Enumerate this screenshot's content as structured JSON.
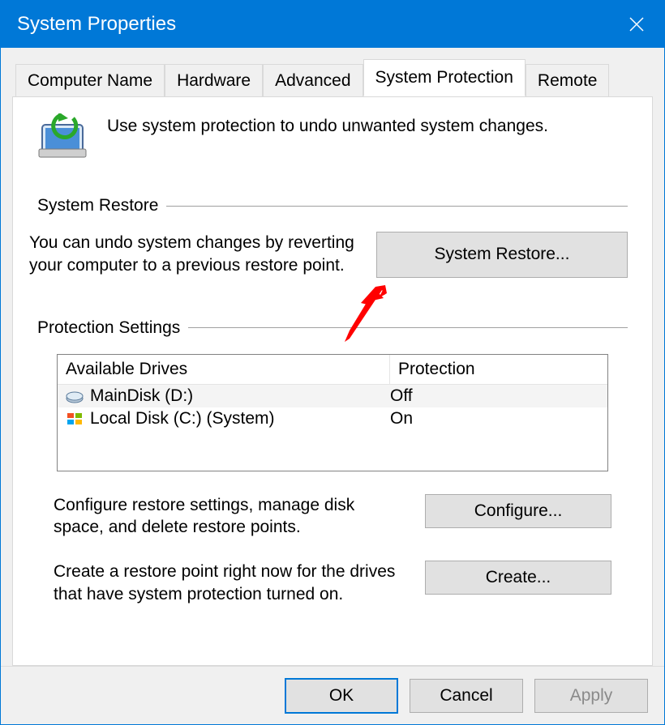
{
  "window": {
    "title": "System Properties"
  },
  "tabs": {
    "computer_name": "Computer Name",
    "hardware": "Hardware",
    "advanced": "Advanced",
    "system_protection": "System Protection",
    "remote": "Remote"
  },
  "intro": {
    "text": "Use system protection to undo unwanted system changes."
  },
  "section_restore": {
    "title": "System Restore",
    "desc": "You can undo system changes by reverting your computer to a previous restore point.",
    "button": "System Restore..."
  },
  "section_protection": {
    "title": "Protection Settings",
    "col_drives": "Available Drives",
    "col_protection": "Protection",
    "rows": [
      {
        "name": "MainDisk (D:)",
        "protection": "Off"
      },
      {
        "name": "Local Disk (C:) (System)",
        "protection": "On"
      }
    ],
    "configure_desc": "Configure restore settings, manage disk space, and delete restore points.",
    "configure_btn": "Configure...",
    "create_desc": "Create a restore point right now for the drives that have system protection turned on.",
    "create_btn": "Create..."
  },
  "footer": {
    "ok": "OK",
    "cancel": "Cancel",
    "apply": "Apply"
  }
}
